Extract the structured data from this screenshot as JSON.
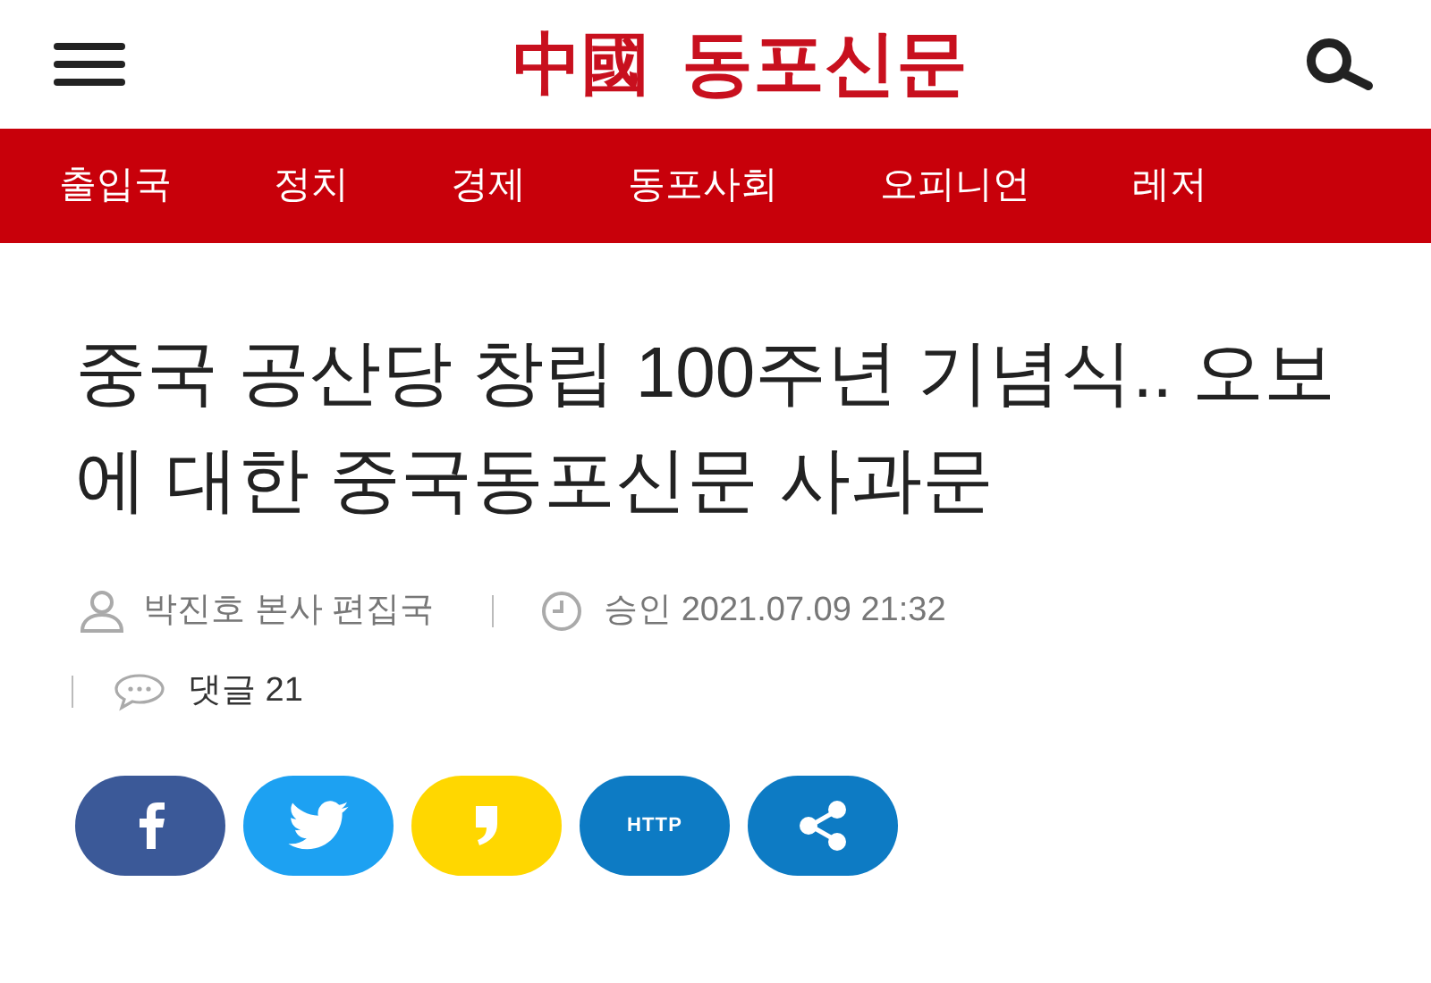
{
  "header": {
    "logo_hanja": "中國",
    "logo_hangul": "동포신문"
  },
  "nav": {
    "items": [
      {
        "label": "출입국"
      },
      {
        "label": "정치"
      },
      {
        "label": "경제"
      },
      {
        "label": "동포사회"
      },
      {
        "label": "오피니언"
      },
      {
        "label": "레저"
      }
    ]
  },
  "article": {
    "title": "중국 공산당 창립 100주년 기념식.. 오보에 대한 중국동포신문 사과문",
    "author": "박진호 본사 편집국",
    "approved": "승인 2021.07.09 21:32",
    "comments": "댓글 21"
  },
  "share": [
    {
      "kind": "facebook"
    },
    {
      "kind": "twitter"
    },
    {
      "kind": "kakaostory"
    },
    {
      "kind": "link",
      "label": "HTTP"
    },
    {
      "kind": "share"
    }
  ]
}
